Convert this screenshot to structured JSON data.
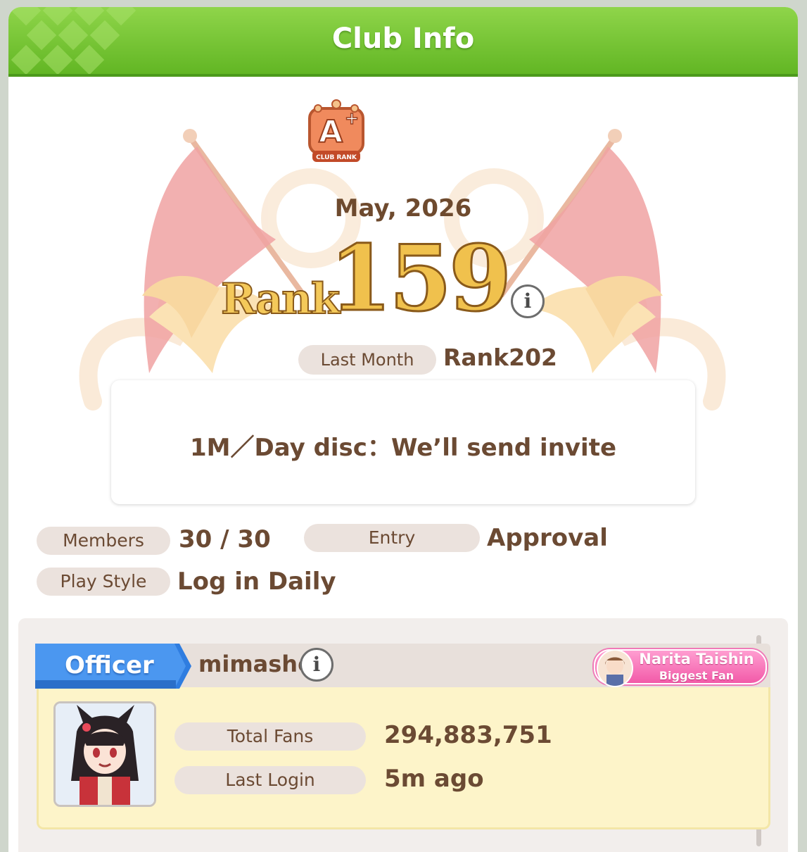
{
  "header": {
    "title": "Club Info"
  },
  "club": {
    "rank_badge": {
      "letter": "A",
      "modifier": "+",
      "caption": "CLUB RANK"
    },
    "month": "May, 2026",
    "rank_label": "Rank",
    "rank_value": "159",
    "last_month_label": "Last Month",
    "last_month_value": "Rank202",
    "description": "1M／Day disc：We’ll send invite"
  },
  "details": {
    "members_label": "Members",
    "members_value": "30 / 30",
    "entry_label": "Entry",
    "entry_value": "Approval",
    "play_style_label": "Play Style",
    "play_style_value": "Log in Daily"
  },
  "member_card": {
    "role": "Officer",
    "name": "mimasho",
    "fan_badge": {
      "line1": "Narita Taishin",
      "line2": "Biggest Fan"
    },
    "stats": [
      {
        "label": "Total Fans",
        "value": "294,883,751"
      },
      {
        "label": "Last Login",
        "value": "5m ago"
      }
    ]
  },
  "colors": {
    "header_green": "#62b624",
    "text_brown": "#6b4a33",
    "officer_blue": "#2f7de0",
    "fan_pink": "#f25aa8",
    "card_yellow": "#fdf4c9"
  },
  "icons": [
    "club-rank-badge-icon",
    "info-icon",
    "character-portrait",
    "fan-avatar-icon"
  ]
}
